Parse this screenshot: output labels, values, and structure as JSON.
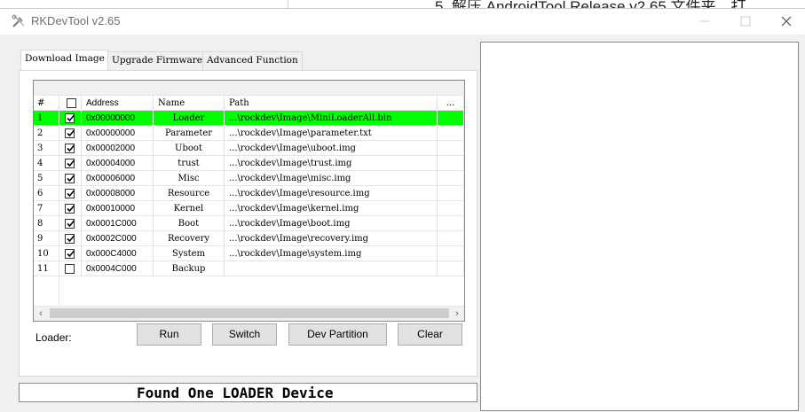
{
  "background_doc": {
    "text": "5. 解压 AndroidTool Release v2.65 文件夹，打"
  },
  "window": {
    "title": "RKDevTool v2.65"
  },
  "tabs": [
    {
      "label": "Download Image",
      "active": true
    },
    {
      "label": "Upgrade Firmware",
      "active": false
    },
    {
      "label": "Advanced Function",
      "active": false
    }
  ],
  "table": {
    "columns": [
      "#",
      "",
      "Address",
      "Name",
      "Path",
      "..."
    ],
    "rows": [
      {
        "num": "1",
        "checked": true,
        "address": "0x00000000",
        "name": "Loader",
        "path": "...\\rockdev\\Image\\MiniLoaderAll.bin",
        "selected": true
      },
      {
        "num": "2",
        "checked": true,
        "address": "0x00000000",
        "name": "Parameter",
        "path": "...\\rockdev\\Image\\parameter.txt"
      },
      {
        "num": "3",
        "checked": true,
        "address": "0x00002000",
        "name": "Uboot",
        "path": "...\\rockdev\\Image\\uboot.img"
      },
      {
        "num": "4",
        "checked": true,
        "address": "0x00004000",
        "name": "trust",
        "path": "...\\rockdev\\Image\\trust.img"
      },
      {
        "num": "5",
        "checked": true,
        "address": "0x00006000",
        "name": "Misc",
        "path": "...\\rockdev\\Image\\misc.img"
      },
      {
        "num": "6",
        "checked": true,
        "address": "0x00008000",
        "name": "Resource",
        "path": "...\\rockdev\\Image\\resource.img"
      },
      {
        "num": "7",
        "checked": true,
        "address": "0x00010000",
        "name": "Kernel",
        "path": "...\\rockdev\\Image\\kernel.img"
      },
      {
        "num": "8",
        "checked": true,
        "address": "0x0001C000",
        "name": "Boot",
        "path": "...\\rockdev\\Image\\boot.img"
      },
      {
        "num": "9",
        "checked": true,
        "address": "0x0002C000",
        "name": "Recovery",
        "path": "...\\rockdev\\Image\\recovery.img"
      },
      {
        "num": "10",
        "checked": true,
        "address": "0x000C4000",
        "name": "System",
        "path": "...\\rockdev\\Image\\system.img"
      },
      {
        "num": "11",
        "checked": false,
        "address": "0x0004C000",
        "name": "Backup",
        "path": ""
      }
    ]
  },
  "loader_label": "Loader:",
  "buttons": {
    "run": "Run",
    "switch": "Switch",
    "dev_partition": "Dev Partition",
    "clear": "Clear"
  },
  "status": "Found One LOADER Device",
  "colors": {
    "selected_row": "#00ff00"
  }
}
